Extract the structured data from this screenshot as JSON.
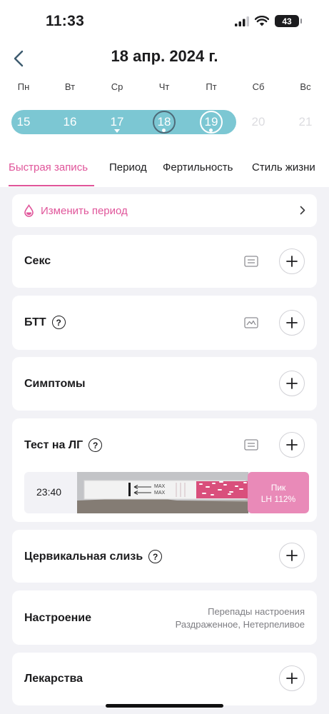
{
  "status_bar": {
    "time": "11:33",
    "battery": "43"
  },
  "header": {
    "title": "18 апр. 2024 г."
  },
  "calendar": {
    "weekdays": [
      "Пн",
      "Вт",
      "Ср",
      "Чт",
      "Пт",
      "Сб",
      "Вс"
    ],
    "dates": [
      "15",
      "16",
      "17",
      "18",
      "19",
      "20",
      "21"
    ],
    "period_band_color": "#7cc7d3"
  },
  "tabs": [
    "Быстрая запись",
    "Период",
    "Фертильность",
    "Стиль жизни"
  ],
  "period_link": {
    "label": "Изменить период"
  },
  "sections": {
    "sex": "Секс",
    "btt": "БТТ",
    "symptoms": "Симптомы",
    "lh_test": "Тест на ЛГ",
    "cervical": "Цервикальная слизь",
    "mood": "Настроение",
    "meds": "Лекарства"
  },
  "help_mark": "?",
  "lh_entry": {
    "time": "23:40",
    "strip_text_1": "MAX",
    "strip_text_2": "MAX",
    "result_label": "Пик",
    "result_value": "LH 112%"
  },
  "mood_values": {
    "line1": "Перепады настроения",
    "line2": "Раздраженное, Нетерпеливое"
  },
  "colors": {
    "accent": "#e0559a",
    "period": "#7cc7d3",
    "peak": "#e98ab8"
  }
}
